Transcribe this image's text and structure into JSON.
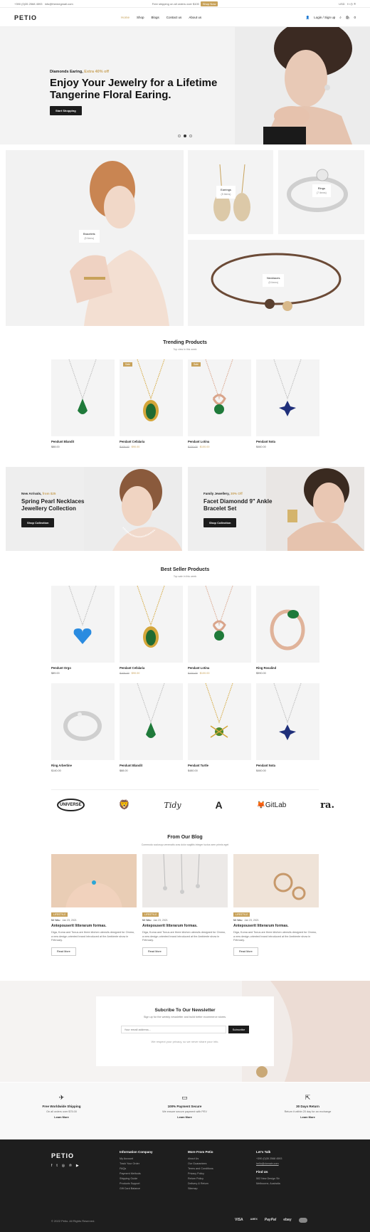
{
  "topbar": {
    "phone": "+390 (0)35 2568 4593",
    "email": "info@themegmail.com",
    "shipping": "Free shipping on all orders over $100",
    "shop_now": "Shop Now",
    "currency": "USD",
    "social": [
      "f",
      "t",
      "i",
      "p"
    ]
  },
  "header": {
    "logo": "PETIO",
    "nav": [
      "Home",
      "Shop",
      "Blogs",
      "Contact us",
      "About us"
    ],
    "login": "Login / Sign up",
    "cart_count": "0"
  },
  "hero": {
    "subtitle_prefix": "Diamonds Earing,",
    "subtitle_highlight": "Extra 40% off",
    "title": "Enjoy Your Jewelry for a Lifetime Tangerine Floral Earing.",
    "button": "Start Shopping"
  },
  "categories": [
    {
      "name": "Bracelets",
      "count": "(5 Items)"
    },
    {
      "name": "Earrings",
      "count": "(5 Items)"
    },
    {
      "name": "Rings",
      "count": "(7 Items)"
    },
    {
      "name": "Necklaces",
      "count": "(5 Items)"
    }
  ],
  "trending": {
    "title": "Trending Products",
    "subtitle": "Top view in this week",
    "products": [
      {
        "name": "Pendunt Blandit",
        "price": "$88.00",
        "old": "",
        "sale": false,
        "stone": "green",
        "gold": false
      },
      {
        "name": "Pendant Cefalaria",
        "price": "$90.00",
        "old": "$105.00",
        "sale": true,
        "stone": "green",
        "gold": true
      },
      {
        "name": "Pendant Lotina",
        "price": "$100.00",
        "old": "$120.00",
        "sale": true,
        "stone": "green",
        "gold": "rose"
      },
      {
        "name": "Pendant Nota",
        "price": "$460.00",
        "old": "",
        "sale": false,
        "stone": "blue",
        "gold": false
      }
    ]
  },
  "promos": [
    {
      "pre": "New Arrivals,",
      "hl": "from $25",
      "title": "Spring Pearl Necklaces Jewellery Collection",
      "button": "Shop Collection"
    },
    {
      "pre": "Family Jewellery,",
      "hl": "30% Off",
      "title": "Facet Diamondd 9\" Ankle Bracelet Set",
      "button": "Shop Collection"
    }
  ],
  "bestseller": {
    "title": "Best Seller Products",
    "subtitle": "Top sale in this week",
    "products": [
      {
        "name": "Pendunt Orgo",
        "price": "$89.00",
        "old": "",
        "sale": false
      },
      {
        "name": "Pendant Cefalaria",
        "price": "$90.00",
        "old": "$105.00",
        "sale": false
      },
      {
        "name": "Pendant Lotina",
        "price": "$100.00",
        "old": "$120.00",
        "sale": false
      },
      {
        "name": "Ring Rosalind",
        "price": "$590.00",
        "old": "",
        "sale": false
      },
      {
        "name": "Ring Arbertine",
        "price": "$140.00",
        "old": "",
        "sale": false
      },
      {
        "name": "Pendunt Blandit",
        "price": "$88.00",
        "old": "",
        "sale": false
      },
      {
        "name": "Pendant Turtle",
        "price": "$480.00",
        "old": "",
        "sale": false
      },
      {
        "name": "Pendant Nota",
        "price": "$460.00",
        "old": "",
        "sale": false
      }
    ]
  },
  "brands": [
    "UNIVERSE",
    "LION",
    "Tidy",
    "A",
    "GitLab",
    "ra."
  ],
  "blog": {
    "title": "From Our Blog",
    "subtitle": "Commodo sociosqu venenatis cras dolor sagittis integer luctus sem primis eget",
    "posts": [
      {
        "tag": "LIFESTYLE",
        "author": "Mr Wau",
        "date": "Jan 23, 2021",
        "title": "Antepouserit litterarum formas.",
        "excerpt": "Diga, Koma and Tonus are three kitchen utensils designed for Ommo, a new design-oriented brand introduced at the Ambiente show in February.",
        "more": "Read More"
      },
      {
        "tag": "LIFESTYLE",
        "author": "Mr Wau",
        "date": "Jan 23, 2021",
        "title": "Antepouserit litterarum formas.",
        "excerpt": "Diga, Koma and Tonus are three kitchen utensils designed for Ommo, a new design-oriented brand introduced at the Ambiente show in February.",
        "more": "Read More"
      },
      {
        "tag": "LIFESTYLE",
        "author": "Mr Wau",
        "date": "Jan 23, 2021",
        "title": "Antepouserit litterarum formas.",
        "excerpt": "Diga, Koma and Tonus are three kitchen utensils designed for Ommo, a new design-oriented brand introduced at the Ambiente show in February.",
        "more": "Read More"
      }
    ]
  },
  "newsletter": {
    "title": "Subcribe To Our Newsletter",
    "subtitle": "Sign up for the weekly newsletter and build better ecommerce stores.",
    "placeholder": "Your email address...",
    "button": "Subscribe",
    "note": "We respect your privacy, so we never share your info."
  },
  "features": [
    {
      "title": "Free Worldwide Shipping",
      "desc": "On all orders over $75.00",
      "more": "Learn More"
    },
    {
      "title": "100% Payment Secure",
      "desc": "We ensure secure payment with PEV",
      "more": "Learn More"
    },
    {
      "title": "30 Days Return",
      "desc": "Return it within 20 day for an exchange",
      "more": "Learn More"
    }
  ],
  "footer": {
    "logo": "PETIO",
    "info_title": "Information Company",
    "info_links": [
      "My Account",
      "Track Your Order",
      "FAQs",
      "Payment Methods",
      "Shipping Guide",
      "Products Support",
      "Gift Card Balance"
    ],
    "more_title": "More From Petio",
    "more_links": [
      "About Us",
      "Our Guarantees",
      "Terms and Conditions",
      "Privacy Policy",
      "Return Policy",
      "Delivery & Return",
      "Sitemap"
    ],
    "talk_title": "Let's Talk",
    "talk_phone": "+390 (0)35 2568 4593",
    "talk_email": "hello@domain.com",
    "find_title": "Find Us",
    "find_addr1": "502 New Design Str",
    "find_addr2": "Melbourne, Australia",
    "copyright": "© 2022 Petio. All Rights Reserved.",
    "payments": [
      "VISA",
      "AMEX",
      "PayPal",
      "ebay",
      "MC"
    ]
  },
  "colors": {
    "accent": "#c8a25a",
    "dark": "#1e1e1e"
  }
}
